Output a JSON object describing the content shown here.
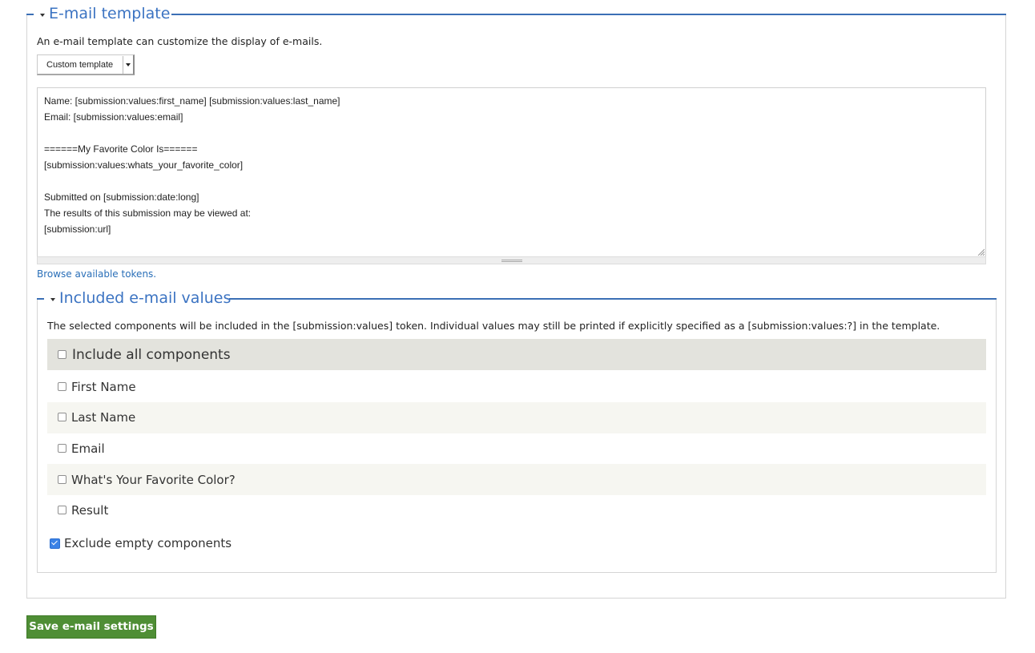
{
  "email_template": {
    "legend": "E-mail template",
    "description": "An e-mail template can customize the display of e-mails.",
    "template_select": {
      "selected": "Custom template"
    },
    "template_lines": [
      "Name: [submission:values:first_name] [submission:values:last_name]",
      "Email: [submission:values:email]",
      "",
      "======My Favorite Color Is======",
      "[submission:values:whats_your_favorite_color]",
      "",
      "Submitted on [submission:date:long]",
      "The results of this submission may be viewed at:",
      "[submission:url]"
    ],
    "browse_tokens_link": "Browse available tokens."
  },
  "included_values": {
    "legend": "Included e-mail values",
    "description": "The selected components will be included in the [submission:values] token. Individual values may still be printed if explicitly specified as a [submission:values:?] in the template.",
    "include_all": {
      "label": "Include all components",
      "checked": false
    },
    "components": [
      {
        "label": "First Name",
        "checked": false
      },
      {
        "label": "Last Name",
        "checked": false
      },
      {
        "label": "Email",
        "checked": false
      },
      {
        "label": "What's Your Favorite Color?",
        "checked": false
      },
      {
        "label": "Result",
        "checked": false
      }
    ],
    "exclude_empty": {
      "label": "Exclude empty components",
      "checked": true
    }
  },
  "actions": {
    "save_label": "Save e-mail settings"
  },
  "colors": {
    "legend_blue": "#3b73c2",
    "link_blue": "#2a6fb8",
    "save_green": "#4f8e35",
    "checkbox_checked": "#3b82e6"
  }
}
